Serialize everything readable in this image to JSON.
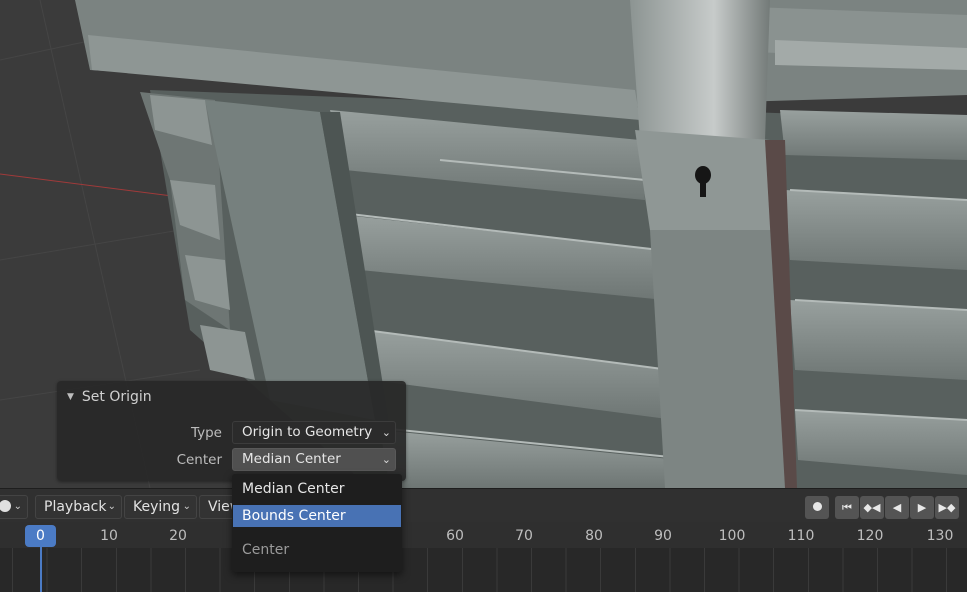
{
  "operator_panel": {
    "title": "Set Origin",
    "type_label": "Type",
    "type_value": "Origin to Geometry",
    "center_label": "Center",
    "center_value": "Median Center"
  },
  "dropdown": {
    "items": [
      {
        "label": "Median Center",
        "selected": false
      },
      {
        "label": "Bounds Center",
        "selected": true
      }
    ],
    "heading": "Center"
  },
  "timeline": {
    "menus": {
      "playback": "Playback",
      "keying": "Keying",
      "view": "View"
    },
    "current_frame": "0",
    "ticks": [
      "10",
      "20",
      "60",
      "70",
      "80",
      "90",
      "100",
      "110",
      "120",
      "130"
    ]
  },
  "colors": {
    "accent": "#4b7bc5",
    "menu_highlight": "#4872b4"
  }
}
